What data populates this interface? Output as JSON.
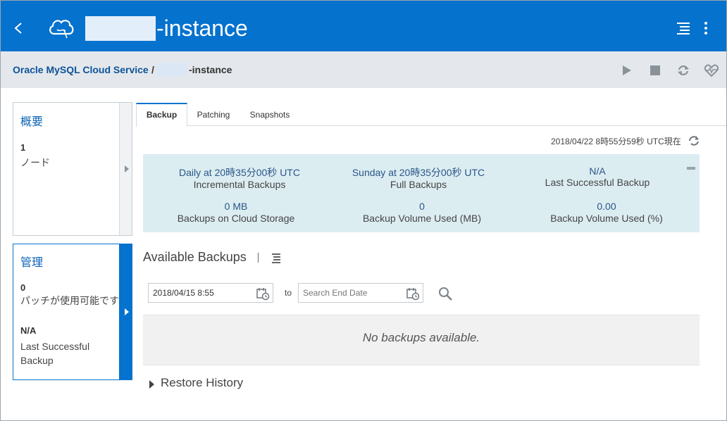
{
  "header": {
    "title": "-instance",
    "back_icon": "chevron-left-icon",
    "logo_icon": "cloud-icon",
    "accent_color": "#0572ce"
  },
  "breadcrumb": {
    "service_link": "Oracle MySQL Cloud Service",
    "separator": "/",
    "current": "-instance"
  },
  "toolbar": {
    "icons": [
      "play-icon",
      "stop-icon",
      "restart-icon",
      "heartbeat-icon"
    ]
  },
  "cards": {
    "overview": {
      "title": "概要",
      "count": "1",
      "label": "ノード"
    },
    "admin": {
      "title": "管理",
      "count": "0",
      "label": "パッチが使用可能です",
      "status_value": "N/A",
      "status_label": "Last Successful Backup"
    }
  },
  "tabs": [
    "Backup",
    "Patching",
    "Snapshots"
  ],
  "as_of": "2018/04/22 8時55分59秒 UTC現在",
  "summary": {
    "incremental_value": "Daily at 20時35分00秒 UTC",
    "incremental_label": "Incremental Backups",
    "full_value": "Sunday at 20時35分00秒 UTC",
    "full_label": "Full Backups",
    "last_value": "N/A",
    "last_label": "Last Successful Backup",
    "storage_value": "0 MB",
    "storage_label": "Backups on Cloud Storage",
    "volume_mb_value": "0",
    "volume_mb_label": "Backup Volume Used (MB)",
    "volume_pct_value": "0.00",
    "volume_pct_label": "Backup Volume Used (%)"
  },
  "available": {
    "title": "Available Backups",
    "start_date": "2018/04/15 8:55",
    "to_label": "to",
    "end_placeholder": "Search End Date",
    "empty_message": "No backups available."
  },
  "restore_history": {
    "label": "Restore History"
  }
}
